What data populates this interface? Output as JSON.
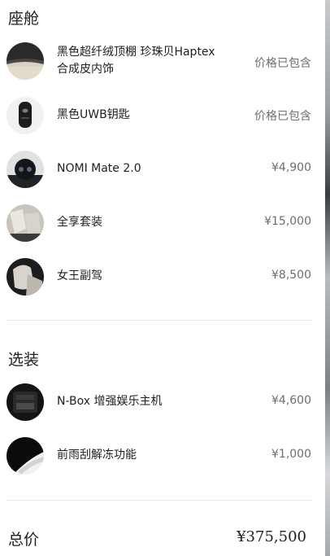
{
  "cabin": {
    "title": "座舱",
    "items": [
      {
        "line1": "黑色超纤绒顶棚 珍珠贝Haptex",
        "line2": "合成皮内饰",
        "price": "价格已包含",
        "icon": "interior-trim-swatch-icon"
      },
      {
        "line1": "黑色UWB钥匙",
        "line2": "",
        "price": "价格已包含",
        "icon": "uwb-key-icon"
      },
      {
        "line1": "NOMI Mate 2.0",
        "line2": "",
        "price": "¥4,900",
        "icon": "nomi-mate-icon"
      },
      {
        "line1": "全享套装",
        "line2": "",
        "price": "¥15,000",
        "icon": "full-package-seats-icon"
      },
      {
        "line1": "女王副驾",
        "line2": "",
        "price": "¥8,500",
        "icon": "queen-copilot-seat-icon"
      }
    ]
  },
  "options": {
    "title": "选装",
    "items": [
      {
        "line1": "N-Box 增强娱乐主机",
        "line2": "",
        "price": "¥4,600",
        "icon": "nbox-console-icon"
      },
      {
        "line1": "前雨刮解冻功能",
        "line2": "",
        "price": "¥1,000",
        "icon": "wiper-defrost-icon"
      }
    ]
  },
  "total": {
    "label": "总价",
    "value": "¥375,500"
  }
}
